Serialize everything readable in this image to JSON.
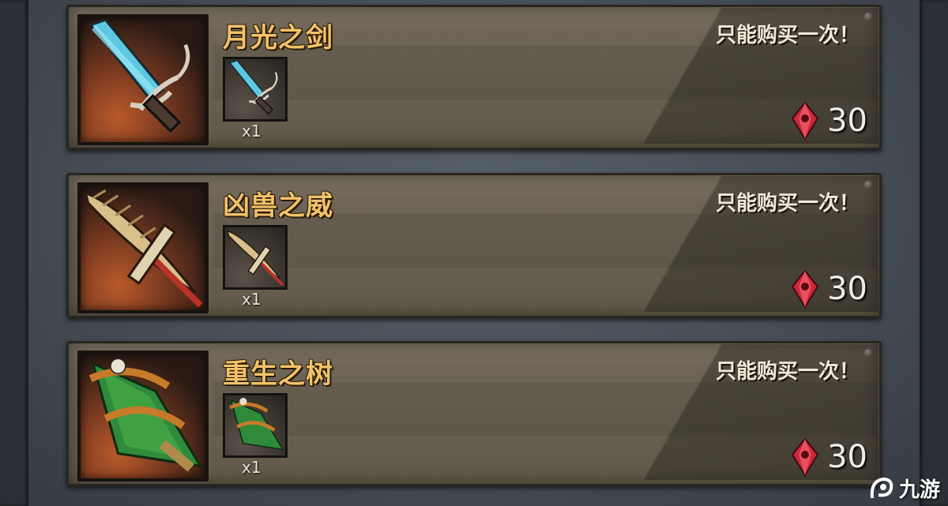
{
  "items": [
    {
      "title": "月光之剑",
      "limit": "只能购买一次！",
      "quantity": "x1",
      "price": "30",
      "icon": "crystal-sword-icon"
    },
    {
      "title": "凶兽之威",
      "limit": "只能购买一次！",
      "quantity": "x1",
      "price": "30",
      "icon": "feather-blade-icon"
    },
    {
      "title": "重生之树",
      "limit": "只能购买一次！",
      "quantity": "x1",
      "price": "30",
      "icon": "skull-tree-icon"
    }
  ],
  "currency_icon": "red-gem-icon",
  "watermark": {
    "text": "九游"
  },
  "colors": {
    "title": "#f2c26a",
    "panel": "#6e6556",
    "background": "#454d55"
  }
}
